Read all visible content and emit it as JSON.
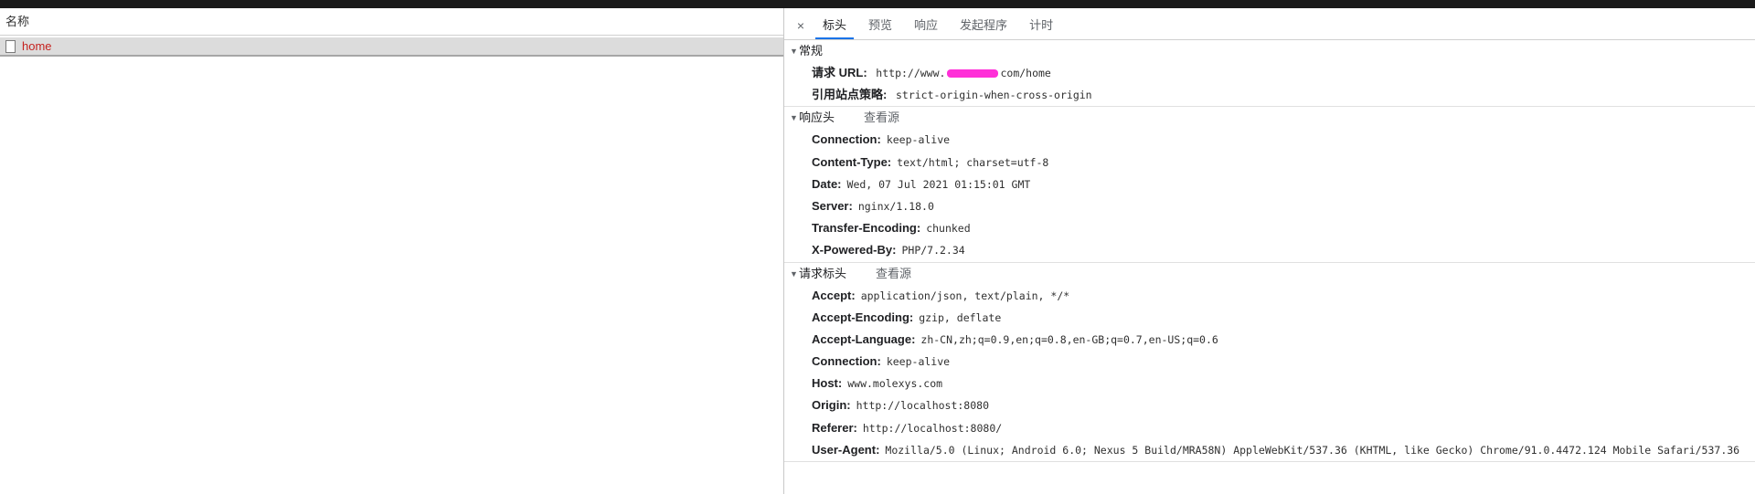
{
  "list": {
    "column_header": "名称",
    "requests": [
      {
        "name": "home"
      }
    ]
  },
  "tabs": [
    "标头",
    "预览",
    "响应",
    "发起程序",
    "计时"
  ],
  "close_glyph": "×",
  "general": {
    "title": "常规",
    "url_label": "请求 URL:",
    "url_prefix": "http://www.",
    "url_suffix": "com/home",
    "policy_label": "引用站点策略:",
    "policy_value": "strict-origin-when-cross-origin"
  },
  "response_headers": {
    "title": "响应头",
    "view_source": "查看源",
    "items": [
      {
        "k": "Connection:",
        "v": "keep-alive"
      },
      {
        "k": "Content-Type:",
        "v": "text/html; charset=utf-8"
      },
      {
        "k": "Date:",
        "v": "Wed, 07 Jul 2021 01:15:01 GMT"
      },
      {
        "k": "Server:",
        "v": "nginx/1.18.0"
      },
      {
        "k": "Transfer-Encoding:",
        "v": "chunked"
      },
      {
        "k": "X-Powered-By:",
        "v": "PHP/7.2.34"
      }
    ]
  },
  "request_headers": {
    "title": "请求标头",
    "view_source": "查看源",
    "items": [
      {
        "k": "Accept:",
        "v": "application/json, text/plain, */*"
      },
      {
        "k": "Accept-Encoding:",
        "v": "gzip, deflate"
      },
      {
        "k": "Accept-Language:",
        "v": "zh-CN,zh;q=0.9,en;q=0.8,en-GB;q=0.7,en-US;q=0.6"
      },
      {
        "k": "Connection:",
        "v": "keep-alive"
      },
      {
        "k": "Host:",
        "v": "www.molexys.com"
      },
      {
        "k": "Origin:",
        "v": "http://localhost:8080"
      },
      {
        "k": "Referer:",
        "v": "http://localhost:8080/"
      },
      {
        "k": "User-Agent:",
        "v": "Mozilla/5.0 (Linux; Android 6.0; Nexus 5 Build/MRA58N) AppleWebKit/537.36 (KHTML, like Gecko) Chrome/91.0.4472.124 Mobile Safari/537.36"
      }
    ]
  },
  "colors": {
    "active_tab_underline": "#1a73e8",
    "request_name": "#c5221f",
    "redaction": "#ff2fd8"
  }
}
